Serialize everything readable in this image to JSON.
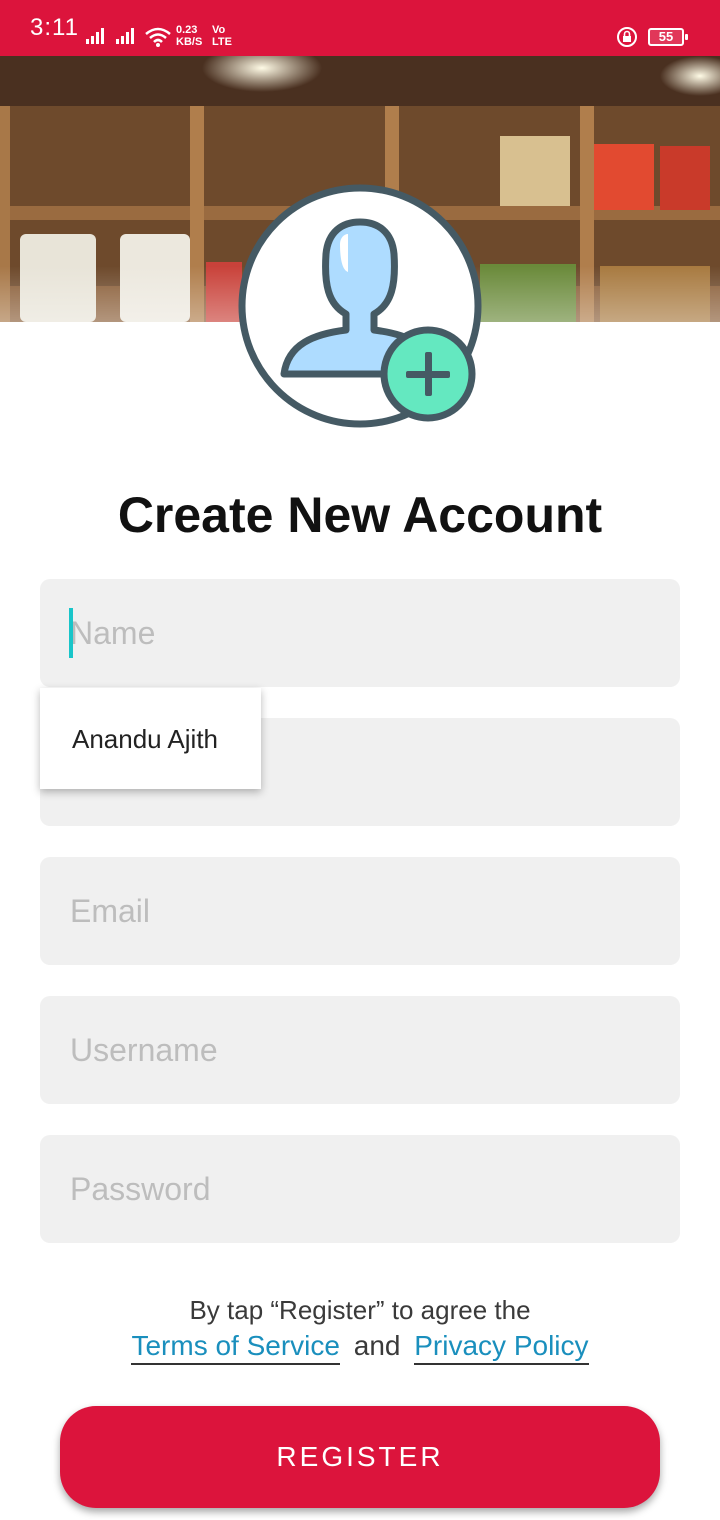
{
  "status_bar": {
    "time": "3:11",
    "net_speed_value": "0.23",
    "net_speed_unit": "KB/S",
    "volte_top": "Vo",
    "volte_bottom": "LTE",
    "battery": "55",
    "color": "#dc143c"
  },
  "header": {
    "image": "shop-shelves-photo",
    "avatar_icon": "add-user-icon"
  },
  "title": "Create New Account",
  "form": {
    "name_placeholder": "Name",
    "phone_placeholder": "",
    "email_placeholder": "Email",
    "username_placeholder": "Username",
    "password_placeholder": "Password",
    "autofill_suggestion": "Anandu Ajith"
  },
  "terms": {
    "line1": "By tap “Register” to agree the",
    "terms_link": "Terms of Service",
    "and": "and",
    "privacy_link": "Privacy Policy"
  },
  "register_label": "REGISTER",
  "colors": {
    "accent": "#dc143c",
    "link": "#1a8fbd",
    "field_bg": "#f0f0f0",
    "cursor": "#19c5c9"
  }
}
